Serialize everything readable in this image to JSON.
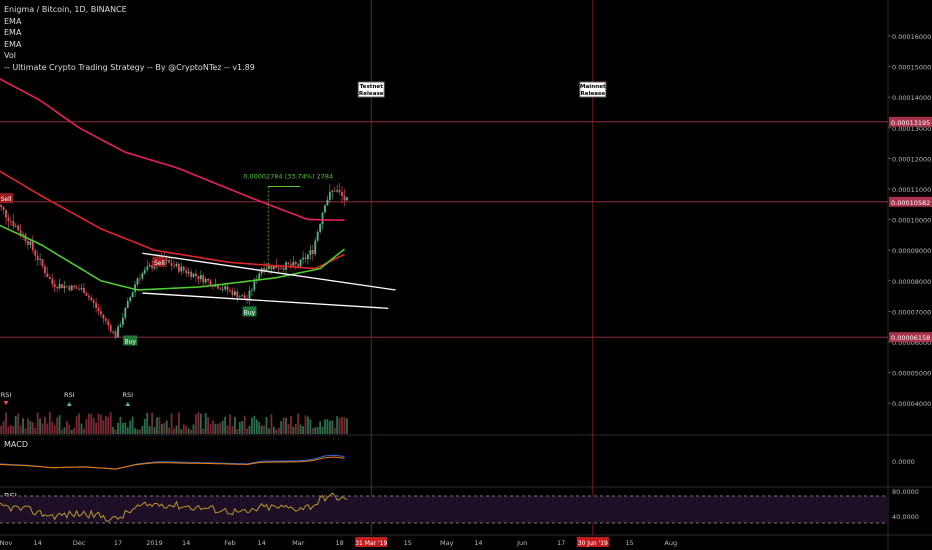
{
  "legend": {
    "symbol": "Enigma / Bitcoin, 1D, BINANCE",
    "ema1": "EMA",
    "ema2": "EMA",
    "ema3": "EMA",
    "vol": "Vol",
    "strategy": "-- Ultimate Crypto Trading Strategy -- By @CryptoNTez -- v1.89"
  },
  "panes": {
    "macd": "MACD",
    "rsi": "RSI"
  },
  "colors": {
    "background": "#000000",
    "up": "#53b987",
    "down": "#eb4d5c",
    "ema200": "#e91e63",
    "ema100": "#e0252a",
    "ema50": "#4ecb2e",
    "hline": "#a8324a",
    "vline": "#a01c1c",
    "trend": "#ffffff",
    "macd": "#2f6fd8",
    "signal": "#f57c00",
    "rsi": "#c9a227"
  },
  "chart_data": {
    "type": "candlestick",
    "title": "Enigma / Bitcoin, 1D, BINANCE",
    "ylim": [
      3.3e-05,
      0.000175
    ],
    "y_ticks": [
      "0.00004000",
      "0.00005000",
      "0.00006000",
      "0.00007000",
      "0.00008000",
      "0.00009000",
      "0.00010000",
      "0.00011000",
      "0.00012000",
      "0.00013000",
      "0.00014000",
      "0.00015000",
      "0.00016000",
      "0.00017000"
    ],
    "x_ticks": [
      {
        "label": "Nov",
        "date": "2018-11-01"
      },
      {
        "label": "14",
        "date": "2018-11-14"
      },
      {
        "label": "Dec",
        "date": "2018-12-01"
      },
      {
        "label": "17",
        "date": "2018-12-17"
      },
      {
        "label": "2019",
        "date": "2019-01-01"
      },
      {
        "label": "14",
        "date": "2019-01-14"
      },
      {
        "label": "Feb",
        "date": "2019-02-01"
      },
      {
        "label": "14",
        "date": "2019-02-14"
      },
      {
        "label": "Mar",
        "date": "2019-03-01"
      },
      {
        "label": "18",
        "date": "2019-03-18"
      },
      {
        "label": "15",
        "date": "2019-04-15"
      },
      {
        "label": "May",
        "date": "2019-05-01"
      },
      {
        "label": "14",
        "date": "2019-05-14"
      },
      {
        "label": "Jun",
        "date": "2019-06-01"
      },
      {
        "label": "17",
        "date": "2019-06-17"
      },
      {
        "label": "15",
        "date": "2019-07-15"
      },
      {
        "label": "Aug",
        "date": "2019-08-01"
      }
    ],
    "price_key_points": [
      {
        "date": "2018-10-27",
        "price": 0.0001065
      },
      {
        "date": "2018-11-10",
        "price": 9.3e-05
      },
      {
        "date": "2018-11-20",
        "price": 7.9e-05
      },
      {
        "date": "2018-12-03",
        "price": 7.7e-05
      },
      {
        "date": "2018-12-16",
        "price": 6.2e-05
      },
      {
        "date": "2018-12-25",
        "price": 8.1e-05
      },
      {
        "date": "2019-01-03",
        "price": 8.7e-05
      },
      {
        "date": "2019-01-20",
        "price": 8.1e-05
      },
      {
        "date": "2019-02-08",
        "price": 7.4e-05
      },
      {
        "date": "2019-02-14",
        "price": 8.45e-05
      },
      {
        "date": "2019-03-01",
        "price": 8.5e-05
      },
      {
        "date": "2019-03-07",
        "price": 9e-05
      },
      {
        "date": "2019-03-12",
        "price": 0.000106
      },
      {
        "date": "2019-03-16",
        "price": 0.00011
      },
      {
        "date": "2019-03-21",
        "price": 0.0001058
      }
    ],
    "ema200_points": [
      {
        "date": "2018-10-27",
        "price": 0.000147
      },
      {
        "date": "2018-11-15",
        "price": 0.000139
      },
      {
        "date": "2018-12-01",
        "price": 0.00013
      },
      {
        "date": "2018-12-20",
        "price": 0.000122
      },
      {
        "date": "2019-01-10",
        "price": 0.000117
      },
      {
        "date": "2019-02-10",
        "price": 0.000107
      },
      {
        "date": "2019-03-05",
        "price": 0.0001
      },
      {
        "date": "2019-03-21",
        "price": 9.98e-05
      }
    ],
    "ema100_points": [
      {
        "date": "2018-10-27",
        "price": 0.000117
      },
      {
        "date": "2018-11-15",
        "price": 0.000108
      },
      {
        "date": "2018-12-10",
        "price": 9.7e-05
      },
      {
        "date": "2019-01-01",
        "price": 9e-05
      },
      {
        "date": "2019-02-01",
        "price": 8.6e-05
      },
      {
        "date": "2019-03-08",
        "price": 8.4e-05
      },
      {
        "date": "2019-03-21",
        "price": 8.9e-05
      }
    ],
    "ema50_points": [
      {
        "date": "2018-10-27",
        "price": 9.9e-05
      },
      {
        "date": "2018-11-15",
        "price": 9.2e-05
      },
      {
        "date": "2018-12-10",
        "price": 8e-05
      },
      {
        "date": "2018-12-25",
        "price": 7.7e-05
      },
      {
        "date": "2019-01-20",
        "price": 7.8e-05
      },
      {
        "date": "2019-02-20",
        "price": 8.1e-05
      },
      {
        "date": "2019-03-10",
        "price": 8.4e-05
      },
      {
        "date": "2019-03-21",
        "price": 9.1e-05
      }
    ],
    "horizontal_lines": [
      {
        "price": 0.00013195,
        "label": "0.00013195"
      },
      {
        "price": 0.00010582,
        "label": "0.00010582"
      },
      {
        "price": 6.158e-05,
        "label": "0.00006158"
      }
    ],
    "vertical_lines": [
      {
        "date": "2019-03-31",
        "label": "31 Mar '19",
        "annotation": "Testnet\nRelease"
      },
      {
        "date": "2019-06-30",
        "label": "30 Jun '19",
        "annotation": "Mainnet\nRelease"
      }
    ],
    "trend_lines": [
      {
        "from": {
          "date": "2018-12-27",
          "price": 8.9e-05
        },
        "to": {
          "date": "2019-04-10",
          "price": 7.7e-05
        }
      },
      {
        "from": {
          "date": "2018-12-27",
          "price": 7.6e-05
        },
        "to": {
          "date": "2019-04-07",
          "price": 7.1e-05
        }
      }
    ],
    "measure": {
      "text": "0.00002784 (33.74%) 2784",
      "from": {
        "date": "2019-02-16",
        "price": 8.3e-05
      },
      "to": {
        "date": "2019-03-01",
        "price": 0.0001108
      }
    },
    "signals": [
      {
        "type": "Sell",
        "date": "2018-11-01",
        "price": 0.000107
      },
      {
        "type": "Sell",
        "date": "2019-01-03",
        "price": 8.62e-05
      },
      {
        "type": "Buy",
        "date": "2019-02-09",
        "price": 7e-05
      },
      {
        "type": "Buy",
        "date": "2018-12-22",
        "price": 6.05e-05
      }
    ],
    "rsi_markers": [
      {
        "label": "RSI",
        "date": "2018-11-01",
        "direction": "down"
      },
      {
        "label": "RSI",
        "date": "2018-11-27",
        "direction": "up"
      },
      {
        "label": "RSI",
        "date": "2018-12-21",
        "direction": "up"
      }
    ],
    "macd_ticks": [
      "0.0000"
    ],
    "rsi_ticks": [
      "80.0000",
      "40.0000"
    ]
  }
}
